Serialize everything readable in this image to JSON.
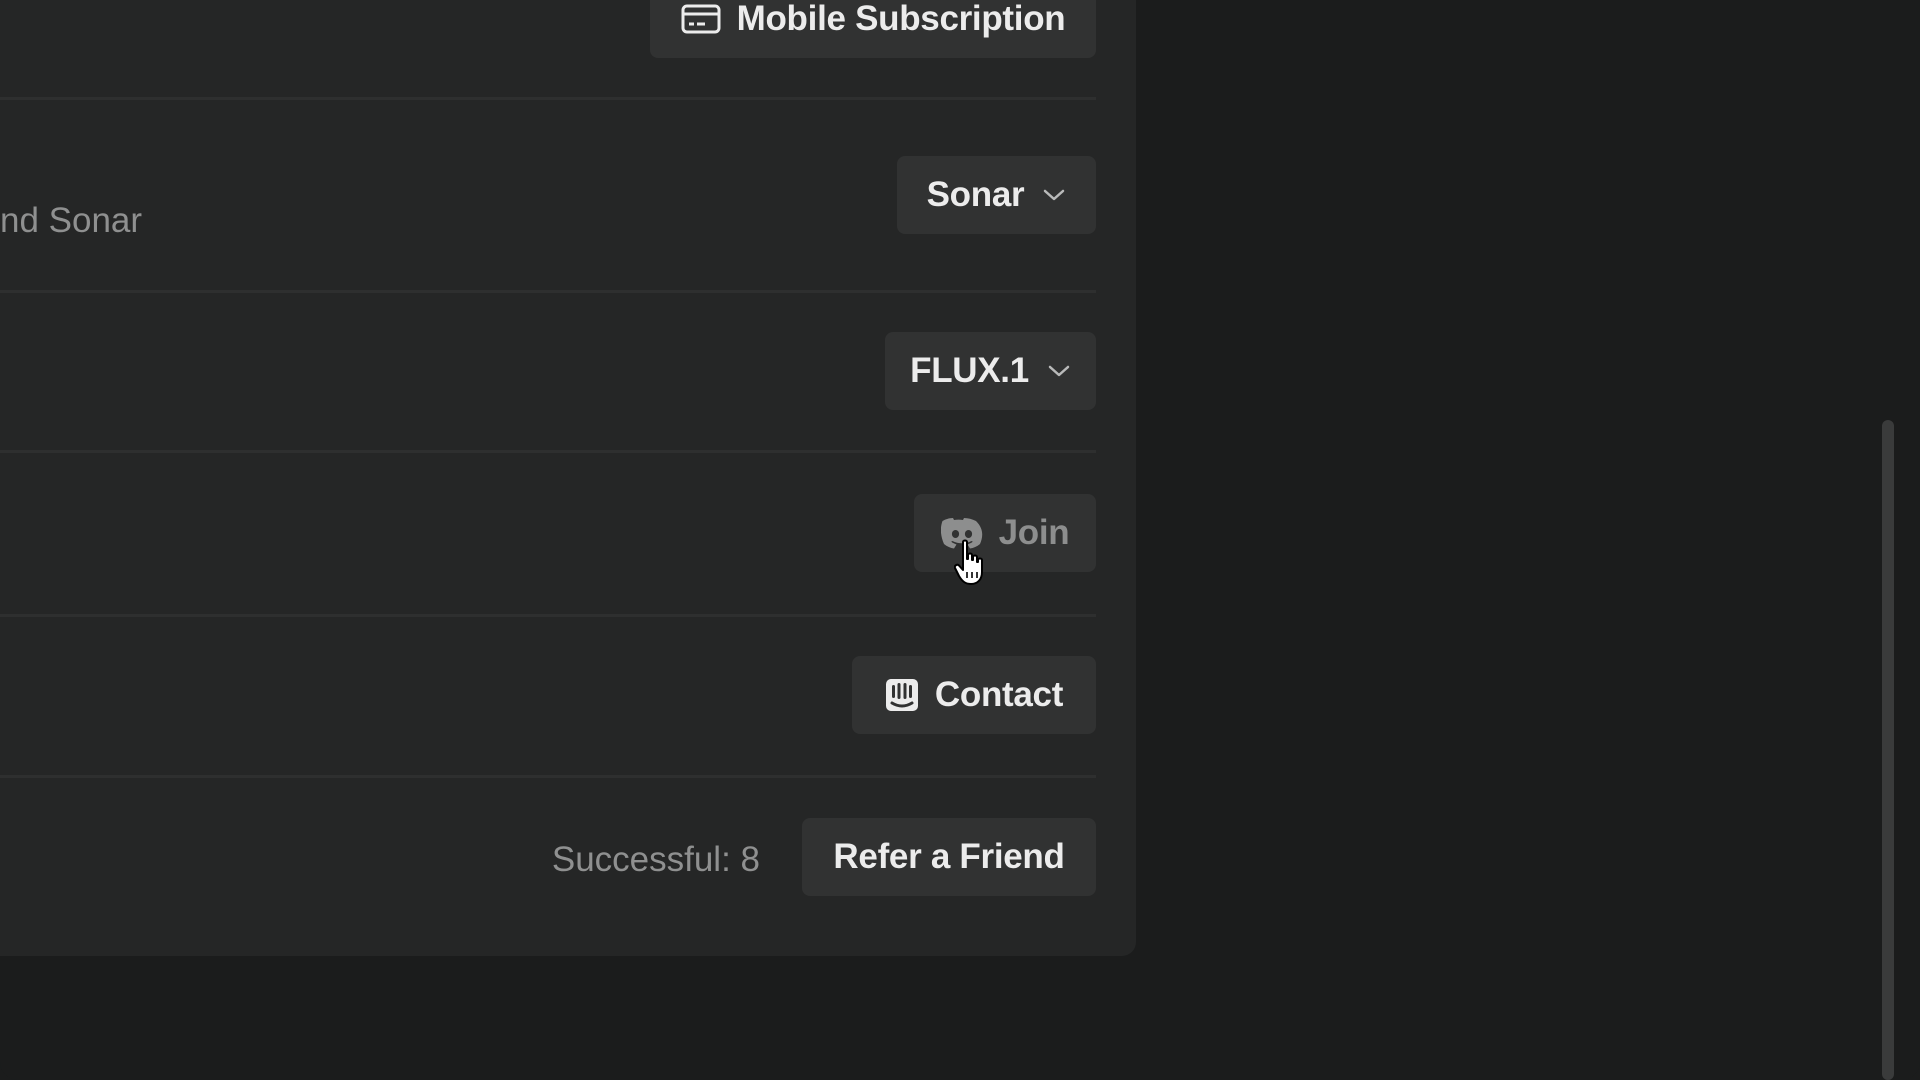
{
  "settings": {
    "subscription_button_label": "Mobile Subscription",
    "search_model": {
      "description": "nd Sonar",
      "selected": "Sonar"
    },
    "image_model": {
      "selected": "FLUX.1"
    },
    "community": {
      "join_label": "Join"
    },
    "support": {
      "contact_label": "Contact"
    },
    "referral": {
      "status": "Successful: 8",
      "button_label": "Refer a Friend"
    }
  },
  "icons": {
    "subscription": "credit-card-icon",
    "dropdown": "chevron-down-icon",
    "join": "discord-icon",
    "contact": "intercom-icon"
  },
  "colors": {
    "page_bg": "#1b1c1c",
    "panel_bg": "#252626",
    "button_bg": "#313232",
    "text_primary": "#ececec",
    "text_muted": "#8f9090"
  }
}
